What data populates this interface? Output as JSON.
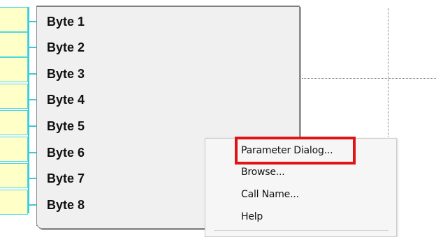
{
  "block": {
    "bytes": [
      "Byte 1",
      "Byte 2",
      "Byte 3",
      "Byte 4",
      "Byte 5",
      "Byte 6",
      "Byte 7",
      "Byte 8"
    ]
  },
  "context_menu": {
    "items": [
      "Parameter Dialog...",
      "Browse...",
      "Call Name...",
      "Help"
    ],
    "highlighted_item": "Parameter Dialog..."
  },
  "colors": {
    "cell_fill": "#ffffc8",
    "connector": "#3fc9d4",
    "block_fill": "#f0f0f0",
    "highlight": "#e01414"
  }
}
